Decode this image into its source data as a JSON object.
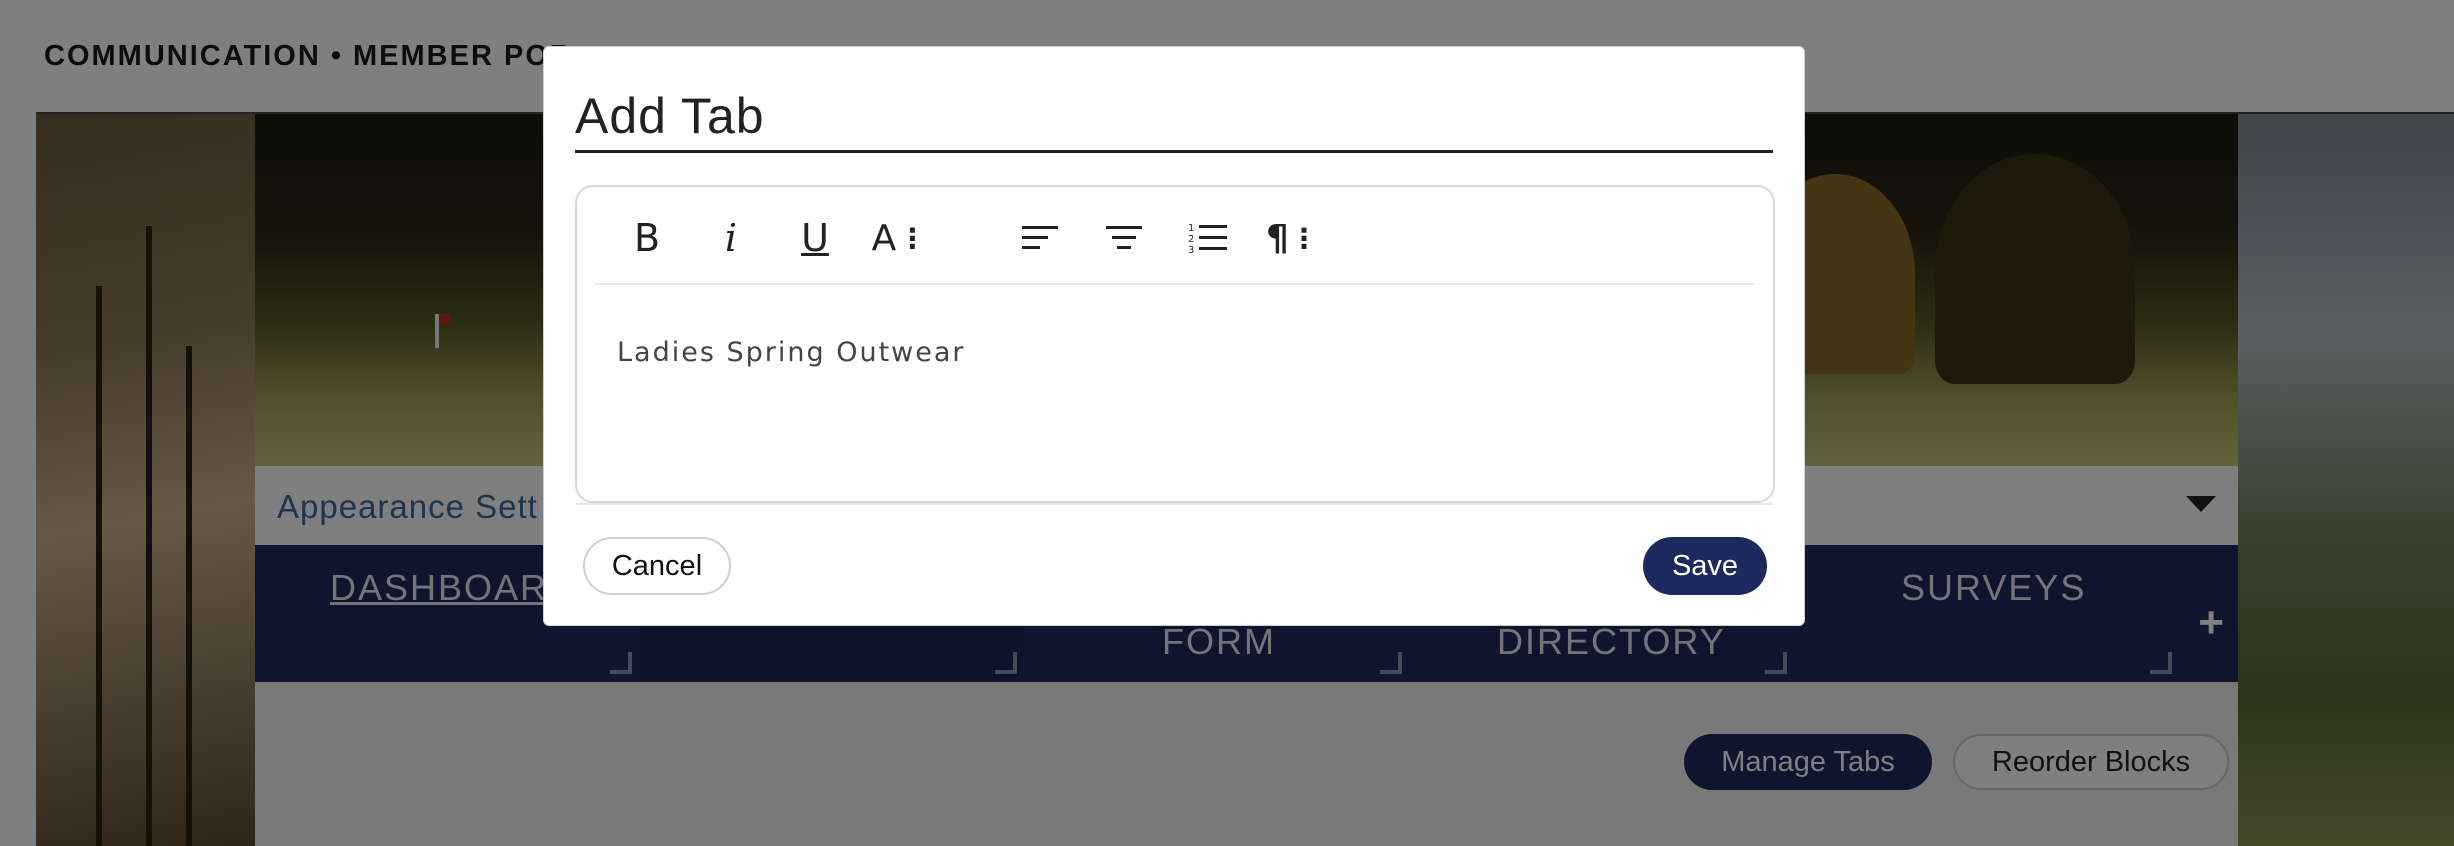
{
  "page": {
    "breadcrumb": "COMMUNICATION • MEMBER POR",
    "appearance_label": "Appearance Sett",
    "tabs": [
      {
        "label": "DASHBOARD"
      },
      {
        "label": "FORM"
      },
      {
        "label": "DIRECTORY"
      },
      {
        "label": "SURVEYS"
      }
    ],
    "add_tab_icon": "plus-icon",
    "manage_tabs_label": "Manage Tabs",
    "reorder_blocks_label": "Reorder Blocks"
  },
  "modal": {
    "title": "Add Tab",
    "toolbar": {
      "icons": [
        "bold-icon",
        "italic-icon",
        "underline-icon",
        "font-size-icon",
        "align-left-icon",
        "align-center-icon",
        "ordered-list-icon",
        "paragraph-icon"
      ],
      "bold_glyph": "B",
      "italic_glyph": "i",
      "underline_glyph": "U",
      "fontsize_glyph": "A",
      "paragraph_glyph": "¶"
    },
    "editor_value": "Ladies Spring Outwear",
    "cancel_label": "Cancel",
    "save_label": "Save"
  },
  "colors": {
    "navy": "#1e2a5e",
    "link_blue": "#3b6aa0",
    "overlay": "rgba(0,0,0,0.5)"
  }
}
